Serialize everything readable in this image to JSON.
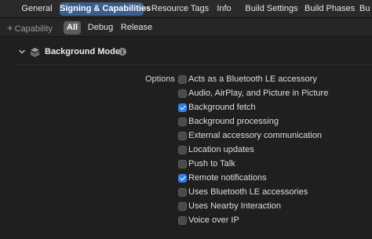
{
  "tabs": [
    {
      "label": "General",
      "active": false
    },
    {
      "label": "Signing & Capabilities",
      "active": true
    },
    {
      "label": "Resource Tags",
      "active": false
    },
    {
      "label": "Info",
      "active": false
    },
    {
      "label": "Build Settings",
      "active": false
    },
    {
      "label": "Build Phases",
      "active": false
    },
    {
      "label": "Bu",
      "active": false
    }
  ],
  "filter": {
    "add_capability_label": "Capability",
    "segments": [
      {
        "label": "All",
        "active": true
      },
      {
        "label": "Debug",
        "active": false
      },
      {
        "label": "Release",
        "active": false
      }
    ]
  },
  "section": {
    "title": "Background Modes",
    "options_label": "Options",
    "options": [
      {
        "label": "Acts as a Bluetooth LE accessory",
        "checked": false
      },
      {
        "label": "Audio, AirPlay, and Picture in Picture",
        "checked": false
      },
      {
        "label": "Background fetch",
        "checked": true
      },
      {
        "label": "Background processing",
        "checked": false
      },
      {
        "label": "External accessory communication",
        "checked": false
      },
      {
        "label": "Location updates",
        "checked": false
      },
      {
        "label": "Push to Talk",
        "checked": false
      },
      {
        "label": "Remote notifications",
        "checked": true
      },
      {
        "label": "Uses Bluetooth LE accessories",
        "checked": false
      },
      {
        "label": "Uses Nearby Interaction",
        "checked": false
      },
      {
        "label": "Voice over IP",
        "checked": false
      }
    ]
  },
  "colors": {
    "accent": "#2f80ed",
    "active_tab": "#3b5e8c",
    "background": "#1f1f1f"
  }
}
